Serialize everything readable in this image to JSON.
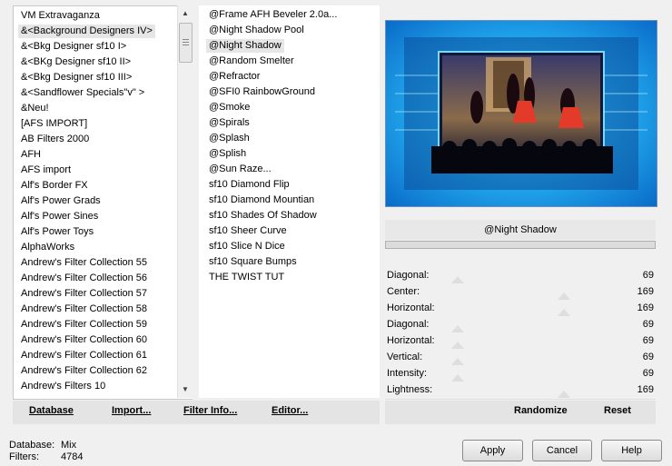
{
  "left_list": [
    "VM Extravaganza",
    "&<Background Designers IV>",
    "&<Bkg Designer sf10 I>",
    "&<BKg Designer sf10 II>",
    "&<Bkg Designer sf10 III>",
    "&<Sandflower Specials\"v\" >",
    "&Neu!",
    "[AFS IMPORT]",
    "AB Filters 2000",
    "AFH",
    "AFS import",
    "Alf's Border FX",
    "Alf's Power Grads",
    "Alf's Power Sines",
    "Alf's Power Toys",
    "AlphaWorks",
    "Andrew's Filter Collection 55",
    "Andrew's Filter Collection 56",
    "Andrew's Filter Collection 57",
    "Andrew's Filter Collection 58",
    "Andrew's Filter Collection 59",
    "Andrew's Filter Collection 60",
    "Andrew's Filter Collection 61",
    "Andrew's Filter Collection 62",
    "Andrew's Filters 10"
  ],
  "left_selected": 1,
  "mid_list": [
    "@Frame AFH Beveler 2.0a...",
    "@Night Shadow Pool",
    "@Night Shadow",
    "@Random Smelter",
    "@Refractor",
    "@SFI0 RainbowGround",
    "@Smoke",
    "@Spirals",
    "@Splash",
    "@Splish",
    "@Sun Raze...",
    "sf10 Diamond Flip",
    "sf10 Diamond Mountian",
    "sf10 Shades Of Shadow",
    "sf10 Sheer Curve",
    "sf10 Slice N Dice",
    "sf10 Square Bumps",
    "THE TWIST TUT"
  ],
  "mid_selected": 2,
  "filter_name": "@Night Shadow",
  "params": [
    {
      "label": "Diagonal:",
      "value": "69",
      "level": 0.27
    },
    {
      "label": "Center:",
      "value": "169",
      "level": 0.66
    },
    {
      "label": "Horizontal:",
      "value": "169",
      "level": 0.66
    },
    {
      "label": "Diagonal:",
      "value": "69",
      "level": 0.27
    },
    {
      "label": "Horizontal:",
      "value": "69",
      "level": 0.27
    },
    {
      "label": "Vertical:",
      "value": "69",
      "level": 0.27
    },
    {
      "label": "Intensity:",
      "value": "69",
      "level": 0.27
    },
    {
      "label": "Lightness:",
      "value": "169",
      "level": 0.66
    }
  ],
  "buttons": {
    "database": "Database",
    "import": "Import...",
    "filter_info": "Filter Info...",
    "editor": "Editor...",
    "randomize": "Randomize",
    "reset": "Reset",
    "apply": "Apply",
    "cancel": "Cancel",
    "help": "Help"
  },
  "status": {
    "database_label": "Database:",
    "database_value": "Mix",
    "filters_label": "Filters:",
    "filters_value": "4784"
  },
  "colors": {
    "preview_blue": "#1aa3ee",
    "preview_dark": "#0a0f2a"
  }
}
